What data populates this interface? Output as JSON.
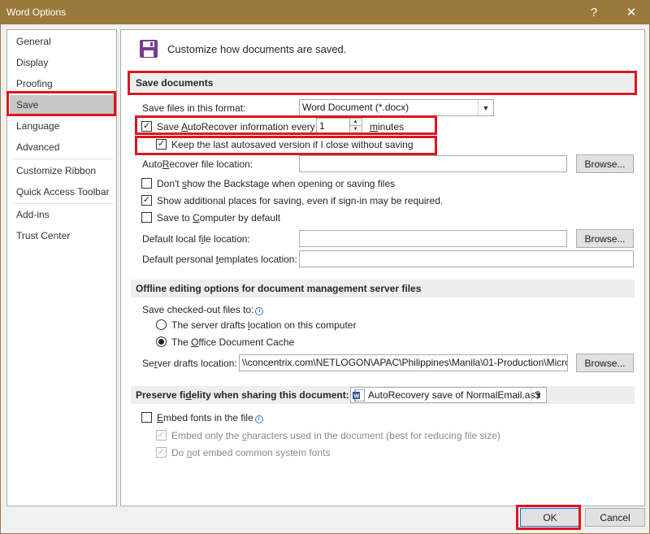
{
  "window": {
    "title": "Word Options",
    "help": "?",
    "close": "✕"
  },
  "nav": {
    "items": [
      "General",
      "Display",
      "Proofing",
      "Save",
      "Language",
      "Advanced",
      "Customize Ribbon",
      "Quick Access Toolbar",
      "Add-ins",
      "Trust Center"
    ],
    "selected": "Save"
  },
  "header": {
    "text": "Customize how documents are saved."
  },
  "save_docs": {
    "heading": "Save documents",
    "format_label": "Save files in this format:",
    "format_value": "Word Document (*.docx)",
    "autorecover_label": "Save AutoRecover information every",
    "autorecover_checked": true,
    "autorecover_minutes": "1",
    "minutes_label": "minutes",
    "keep_last_label": "Keep the last autosaved version if I close without saving",
    "keep_last_checked": true,
    "ar_location_label": "AutoRecover file location:",
    "ar_location_value": "",
    "browse1": "Browse...",
    "dont_show_backstage_label": "Don't show the Backstage when opening or saving files",
    "dont_show_backstage_checked": false,
    "show_additional_label": "Show additional places for saving, even if sign-in may be required.",
    "show_additional_checked": true,
    "save_to_computer_label": "Save to Computer by default",
    "save_to_computer_checked": false,
    "default_local_label": "Default local file location:",
    "default_local_value": "",
    "browse2": "Browse...",
    "default_templates_label": "Default personal templates location:",
    "default_templates_value": ""
  },
  "offline": {
    "heading": "Offline editing options for document management server files",
    "checked_out_label": "Save checked-out files to:",
    "radio1_label": "The server drafts location on this computer",
    "radio1_selected": false,
    "radio2_label": "The Office Document Cache",
    "radio2_selected": true,
    "drafts_label": "Server drafts location:",
    "drafts_value": "\\\\concentrix.com\\NETLOGON\\APAC\\Philippines\\Manila\\01-Production\\Micro",
    "browse3": "Browse..."
  },
  "fidelity": {
    "heading": "Preserve fidelity when sharing this document:",
    "doc_value": "AutoRecovery save of NormalEmail.as$",
    "embed_fonts_label": "Embed fonts in the file",
    "embed_fonts_checked": false,
    "embed_chars_label": "Embed only the characters used in the document (best for reducing file size)",
    "embed_chars_checked": true,
    "no_common_label": "Do not embed common system fonts",
    "no_common_checked": true
  },
  "footer": {
    "ok": "OK",
    "cancel": "Cancel"
  },
  "colors": {
    "titlebar": "#9a7a3c",
    "highlight": "#e0141e",
    "save_icon": "#7a3b8f"
  }
}
